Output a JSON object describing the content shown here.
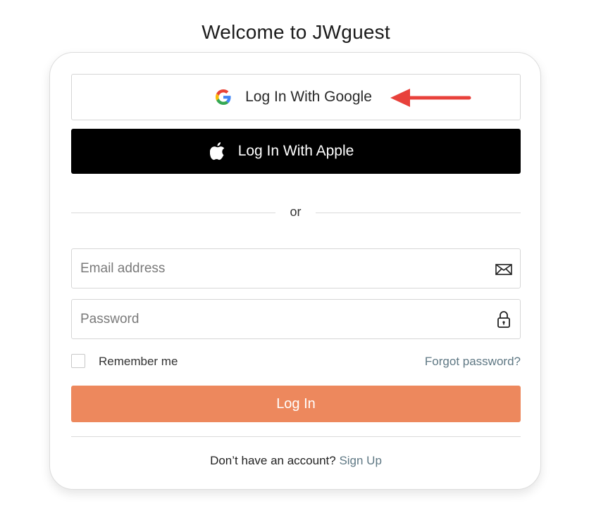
{
  "page_title": "Welcome to JWguest",
  "google_button": {
    "label": "Log In With Google",
    "icon": "google-g-icon"
  },
  "apple_button": {
    "label": "Log In With Apple",
    "icon": "apple-logo-icon"
  },
  "divider": {
    "text": "or"
  },
  "email_field": {
    "placeholder": "Email address",
    "value": "",
    "icon": "envelope-icon"
  },
  "password_field": {
    "placeholder": "Password",
    "value": "",
    "icon": "padlock-icon"
  },
  "remember": {
    "label": "Remember me",
    "checked": false
  },
  "forgot_link": "Forgot password?",
  "login_button": {
    "label": "Log In"
  },
  "signup": {
    "prompt": "Don’t have an account?",
    "link": "Sign Up"
  },
  "colors": {
    "accent": "#ED885D",
    "link": "#5F7884",
    "apple_button_bg": "#000000",
    "annotation_arrow": "#E8413B"
  },
  "annotation": {
    "type": "arrow",
    "pointing_at": "google_button"
  }
}
